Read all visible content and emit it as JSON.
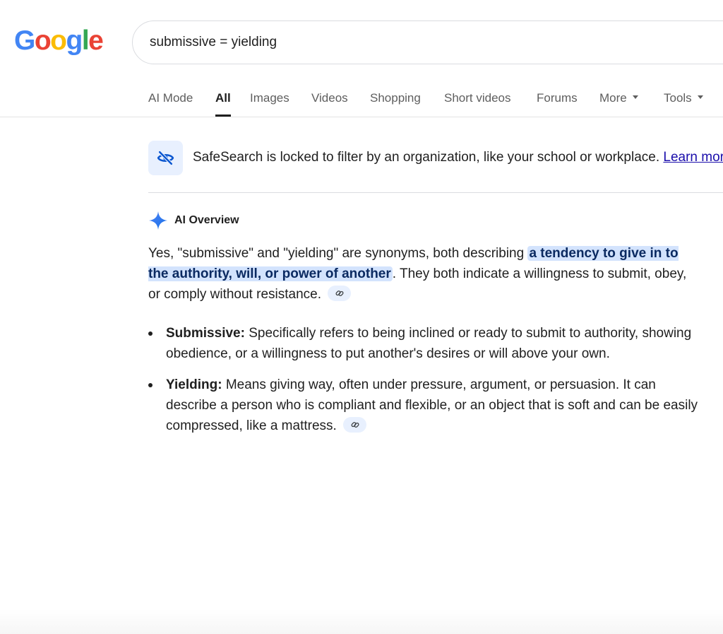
{
  "logo": {
    "letters": [
      "G",
      "o",
      "o",
      "g",
      "l",
      "e"
    ],
    "colors": [
      "#4285F4",
      "#EA4335",
      "#FBBC05",
      "#4285F4",
      "#34A853",
      "#EA4335"
    ]
  },
  "search": {
    "query": "submissive = yielding"
  },
  "tabs": [
    {
      "label": "AI Mode",
      "active": false
    },
    {
      "label": "All",
      "active": true
    },
    {
      "label": "Images",
      "active": false
    },
    {
      "label": "Videos",
      "active": false
    },
    {
      "label": "Shopping",
      "active": false
    },
    {
      "label": "Short videos",
      "active": false
    },
    {
      "label": "Forums",
      "active": false
    },
    {
      "label": "More",
      "active": false,
      "dropdown": true
    },
    {
      "label": "Tools",
      "active": false,
      "dropdown": true
    }
  ],
  "safesearch": {
    "icon": "eye-off-icon",
    "text": "SafeSearch is locked to filter by an organization, like your school or workplace.",
    "link": "Learn more"
  },
  "ai_overview": {
    "icon": "sparkle-icon",
    "title": "AI Overview",
    "intro_before": "Yes, \"submissive\" and \"yielding\" are synonyms, both describing ",
    "intro_highlight": "a tendency to give in to the authority, will, or power of another",
    "intro_after": ". They both indicate a willingness to submit, obey, or comply without resistance.",
    "bullets": [
      {
        "term": "Submissive:",
        "text": "Specifically refers to being inclined or ready to submit to authority, showing obedience, or a willingness to put another's desires or will above your own.",
        "has_link": false
      },
      {
        "term": "Yielding:",
        "text": "Means giving way, often under pressure, argument, or persuasion. It can describe a person who is compliant and flexible, or an object that is soft and can be easily compressed, like a mattress.",
        "has_link": true
      }
    ],
    "link_icon": "link-icon"
  },
  "colors": {
    "accent_blue": "#1a73e8",
    "highlight_bg": "#d3e3fd",
    "link": "#1a0dab"
  }
}
